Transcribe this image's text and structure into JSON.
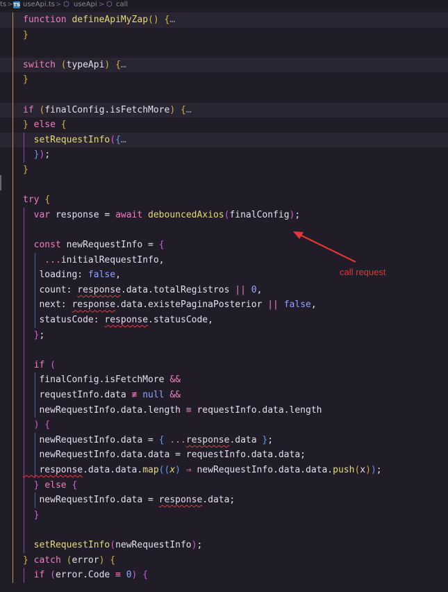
{
  "breadcrumb": {
    "leading": "ts",
    "sep": ">",
    "file_icon": "ts-file-icon",
    "file": "useApi.ts",
    "symbol_icon": "cube-icon",
    "symbol": "useApi",
    "method_icon": "method-icon",
    "method": "call"
  },
  "editor": {
    "lines": [
      [
        [
          "kw",
          "function "
        ],
        [
          "fn",
          "defineApiMyZap"
        ],
        [
          "b1",
          "() {"
        ],
        [
          "ell",
          "…"
        ]
      ],
      [
        [
          "b1",
          "}"
        ]
      ],
      [],
      [
        [
          "kw",
          "switch "
        ],
        [
          "b1",
          "("
        ],
        [
          "v",
          "typeApi"
        ],
        [
          "b1",
          ") {"
        ],
        [
          "ell",
          "…"
        ]
      ],
      [
        [
          "b1",
          "}"
        ]
      ],
      [],
      [
        [
          "kw",
          "if "
        ],
        [
          "b1",
          "("
        ],
        [
          "v",
          "finalConfig.isFetchMore"
        ],
        [
          "b1",
          ") {"
        ],
        [
          "ell",
          "…"
        ]
      ],
      [
        [
          "b1",
          "} "
        ],
        [
          "kw",
          "else "
        ],
        [
          "b1",
          "{"
        ]
      ],
      [
        [
          "fn",
          "  setRequestInfo"
        ],
        [
          "b2",
          "("
        ],
        [
          "b3",
          "{"
        ],
        [
          "ell",
          "…"
        ]
      ],
      [
        [
          "b3",
          "  }"
        ],
        [
          "b2",
          ")"
        ],
        [
          "v",
          ";"
        ]
      ],
      [
        [
          "b1",
          "}"
        ]
      ],
      [],
      [
        [
          "kw",
          "try "
        ],
        [
          "b1",
          "{"
        ]
      ],
      [
        [
          "kw",
          "  var "
        ],
        [
          "v",
          "response = "
        ],
        [
          "kw",
          "await "
        ],
        [
          "fn",
          "debouncedAxios"
        ],
        [
          "b2",
          "("
        ],
        [
          "v",
          "finalConfig"
        ],
        [
          "b2",
          ")"
        ],
        [
          "v",
          ";"
        ]
      ],
      [],
      [
        [
          "kw",
          "  const "
        ],
        [
          "v",
          "newRequestInfo = "
        ],
        [
          "b2",
          "{"
        ]
      ],
      [
        [
          "kw",
          "    ..."
        ],
        [
          "v",
          "initialRequestInfo,"
        ]
      ],
      [
        [
          "v",
          "   loading: "
        ],
        [
          "bool",
          "false"
        ],
        [
          "v",
          ","
        ]
      ],
      [
        [
          "v",
          "   count: "
        ],
        [
          "squig",
          "response"
        ],
        [
          "v",
          ".data.totalRegistros "
        ],
        [
          "op",
          "||"
        ],
        [
          "num",
          " 0"
        ],
        [
          "v",
          ","
        ]
      ],
      [
        [
          "v",
          "   next: "
        ],
        [
          "squig",
          "response"
        ],
        [
          "v",
          ".data.existePaginaPosterior "
        ],
        [
          "op",
          "||"
        ],
        [
          "bool",
          " false"
        ],
        [
          "v",
          ","
        ]
      ],
      [
        [
          "v",
          "   statusCode: "
        ],
        [
          "squig",
          "response"
        ],
        [
          "v",
          ".statusCode,"
        ]
      ],
      [
        [
          "b2",
          "  }"
        ],
        [
          "v",
          ";"
        ]
      ],
      [],
      [
        [
          "kw",
          "  if "
        ],
        [
          "b2",
          "("
        ]
      ],
      [
        [
          "v",
          "   finalConfig.isFetchMore "
        ],
        [
          "op",
          "&&"
        ]
      ],
      [
        [
          "v",
          "   requestInfo.data "
        ],
        [
          "op",
          "≢"
        ],
        [
          "bool",
          " null "
        ],
        [
          "op",
          "&&"
        ]
      ],
      [
        [
          "v",
          "   newRequestInfo.data.length "
        ],
        [
          "op",
          "≡"
        ],
        [
          "v",
          " requestInfo.data.length"
        ]
      ],
      [
        [
          "b2",
          "  ) {"
        ]
      ],
      [
        [
          "v",
          "   newRequestInfo.data = "
        ],
        [
          "b3",
          "{ "
        ],
        [
          "kw",
          "..."
        ],
        [
          "squig",
          "response"
        ],
        [
          "v",
          ".data "
        ],
        [
          "b3",
          "}"
        ],
        [
          "v",
          ";"
        ]
      ],
      [
        [
          "v",
          "   newRequestInfo.data.data = requestInfo.data.data;"
        ]
      ],
      [
        [
          "squig",
          "   response"
        ],
        [
          "v",
          ".data.data."
        ],
        [
          "fn",
          "map"
        ],
        [
          "b3",
          "(("
        ],
        [
          "param",
          "x"
        ],
        [
          "b3",
          ")"
        ],
        [
          "op",
          " ⇒ "
        ],
        [
          "v",
          "newRequestInfo.data.data."
        ],
        [
          "fn",
          "push"
        ],
        [
          "b1",
          "("
        ],
        [
          "v",
          "x"
        ],
        [
          "b1",
          ")"
        ],
        [
          "b3",
          ")"
        ],
        [
          "v",
          ";"
        ]
      ],
      [
        [
          "b2",
          "  } "
        ],
        [
          "kw",
          "else "
        ],
        [
          "b2",
          "{"
        ]
      ],
      [
        [
          "v",
          "   newRequestInfo.data = "
        ],
        [
          "squig",
          "response"
        ],
        [
          "v",
          ".data;"
        ]
      ],
      [
        [
          "b2",
          "  }"
        ]
      ],
      [],
      [
        [
          "fn",
          "  setRequestInfo"
        ],
        [
          "b2",
          "("
        ],
        [
          "v",
          "newRequestInfo"
        ],
        [
          "b2",
          ")"
        ],
        [
          "v",
          ";"
        ]
      ],
      [
        [
          "b1",
          "} "
        ],
        [
          "kw",
          "catch "
        ],
        [
          "b1",
          "("
        ],
        [
          "v",
          "error"
        ],
        [
          "b1",
          ") {"
        ]
      ],
      [
        [
          "kw",
          "  if "
        ],
        [
          "b2",
          "("
        ],
        [
          "v",
          "error.Code "
        ],
        [
          "op",
          "≡"
        ],
        [
          "num",
          " 0"
        ],
        [
          "b2",
          ") {"
        ]
      ]
    ]
  },
  "annotation": {
    "label": "call request",
    "color": "#e53535"
  },
  "colors": {
    "background": "#201c28",
    "keyword": "#f27dc0",
    "function": "#e7db74",
    "boolean": "#8fa3ff",
    "error_squiggle": "#e53d3d"
  }
}
